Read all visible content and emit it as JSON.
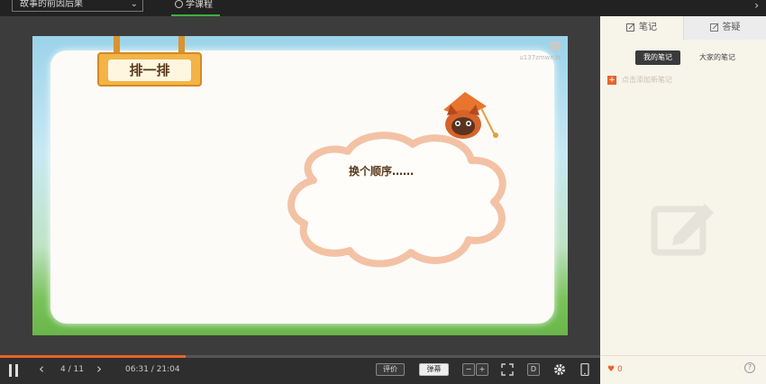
{
  "topbar": {
    "course_title": "故事的前因后果",
    "tab_label": "学课程"
  },
  "slide": {
    "sign_title": "排一排",
    "bubble_text": "换个顺序……",
    "watermark": "u137zmwn3t"
  },
  "controls": {
    "page_current": "4",
    "page_total": "11",
    "page_display": "4 / 11",
    "time_current": "06:31",
    "time_total": "21:04",
    "time_display": "06:31 / 21:04",
    "progress": 0.31,
    "rate_label": "评价",
    "danmu_label": "弹幕",
    "minus_label": "−",
    "plus_label": "+",
    "d_label": "D"
  },
  "panel": {
    "tab_notes": "笔记",
    "tab_qa": "答疑",
    "sub_mine": "我的笔记",
    "sub_all": "大家的笔记",
    "add_note_placeholder": "点击添加新笔记",
    "likes": "0",
    "help": "?"
  },
  "colors": {
    "accent": "#e8632a",
    "tab_underline": "#3fae3f",
    "panel_bg": "#f7f4ea"
  }
}
